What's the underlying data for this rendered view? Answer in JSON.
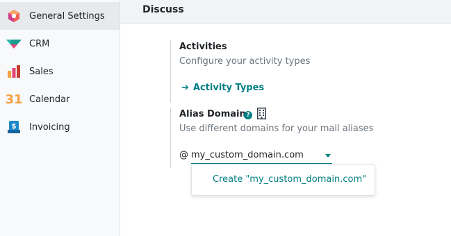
{
  "sidebar": {
    "items": [
      {
        "label": "General Settings",
        "icon": "settings-hexagon-icon",
        "active": true
      },
      {
        "label": "CRM",
        "icon": "crm-icon"
      },
      {
        "label": "Sales",
        "icon": "sales-bars-icon"
      },
      {
        "label": "Calendar",
        "icon": "calendar-31-icon",
        "icon_text": "31"
      },
      {
        "label": "Invoicing",
        "icon": "invoicing-icon"
      }
    ]
  },
  "section": {
    "title": "Discuss"
  },
  "activities": {
    "title": "Activities",
    "description": "Configure your activity types",
    "link_label": "Activity Types",
    "link_arrow": "➔"
  },
  "alias_domain": {
    "title": "Alias Domain",
    "help_icon": "?",
    "description": "Use different domains for your mail aliases",
    "at_sign": "@",
    "value": "my_custom_domain.com",
    "dropdown_option": "Create \"my_custom_domain.com\""
  },
  "colors": {
    "accent": "#017e84",
    "sidebar_bg": "#f8f9fa",
    "active_bg": "#e7e9ed"
  }
}
